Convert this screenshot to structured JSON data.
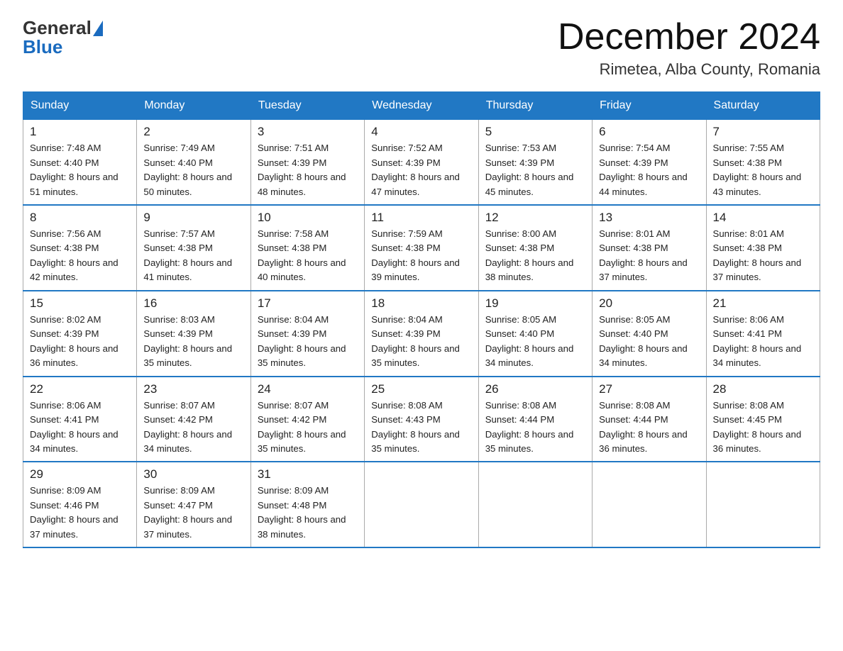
{
  "header": {
    "logo_general": "General",
    "logo_blue": "Blue",
    "title": "December 2024",
    "subtitle": "Rimetea, Alba County, Romania"
  },
  "days_of_week": [
    "Sunday",
    "Monday",
    "Tuesday",
    "Wednesday",
    "Thursday",
    "Friday",
    "Saturday"
  ],
  "weeks": [
    [
      {
        "num": "1",
        "sunrise": "7:48 AM",
        "sunset": "4:40 PM",
        "daylight": "8 hours and 51 minutes."
      },
      {
        "num": "2",
        "sunrise": "7:49 AM",
        "sunset": "4:40 PM",
        "daylight": "8 hours and 50 minutes."
      },
      {
        "num": "3",
        "sunrise": "7:51 AM",
        "sunset": "4:39 PM",
        "daylight": "8 hours and 48 minutes."
      },
      {
        "num": "4",
        "sunrise": "7:52 AM",
        "sunset": "4:39 PM",
        "daylight": "8 hours and 47 minutes."
      },
      {
        "num": "5",
        "sunrise": "7:53 AM",
        "sunset": "4:39 PM",
        "daylight": "8 hours and 45 minutes."
      },
      {
        "num": "6",
        "sunrise": "7:54 AM",
        "sunset": "4:39 PM",
        "daylight": "8 hours and 44 minutes."
      },
      {
        "num": "7",
        "sunrise": "7:55 AM",
        "sunset": "4:38 PM",
        "daylight": "8 hours and 43 minutes."
      }
    ],
    [
      {
        "num": "8",
        "sunrise": "7:56 AM",
        "sunset": "4:38 PM",
        "daylight": "8 hours and 42 minutes."
      },
      {
        "num": "9",
        "sunrise": "7:57 AM",
        "sunset": "4:38 PM",
        "daylight": "8 hours and 41 minutes."
      },
      {
        "num": "10",
        "sunrise": "7:58 AM",
        "sunset": "4:38 PM",
        "daylight": "8 hours and 40 minutes."
      },
      {
        "num": "11",
        "sunrise": "7:59 AM",
        "sunset": "4:38 PM",
        "daylight": "8 hours and 39 minutes."
      },
      {
        "num": "12",
        "sunrise": "8:00 AM",
        "sunset": "4:38 PM",
        "daylight": "8 hours and 38 minutes."
      },
      {
        "num": "13",
        "sunrise": "8:01 AM",
        "sunset": "4:38 PM",
        "daylight": "8 hours and 37 minutes."
      },
      {
        "num": "14",
        "sunrise": "8:01 AM",
        "sunset": "4:38 PM",
        "daylight": "8 hours and 37 minutes."
      }
    ],
    [
      {
        "num": "15",
        "sunrise": "8:02 AM",
        "sunset": "4:39 PM",
        "daylight": "8 hours and 36 minutes."
      },
      {
        "num": "16",
        "sunrise": "8:03 AM",
        "sunset": "4:39 PM",
        "daylight": "8 hours and 35 minutes."
      },
      {
        "num": "17",
        "sunrise": "8:04 AM",
        "sunset": "4:39 PM",
        "daylight": "8 hours and 35 minutes."
      },
      {
        "num": "18",
        "sunrise": "8:04 AM",
        "sunset": "4:39 PM",
        "daylight": "8 hours and 35 minutes."
      },
      {
        "num": "19",
        "sunrise": "8:05 AM",
        "sunset": "4:40 PM",
        "daylight": "8 hours and 34 minutes."
      },
      {
        "num": "20",
        "sunrise": "8:05 AM",
        "sunset": "4:40 PM",
        "daylight": "8 hours and 34 minutes."
      },
      {
        "num": "21",
        "sunrise": "8:06 AM",
        "sunset": "4:41 PM",
        "daylight": "8 hours and 34 minutes."
      }
    ],
    [
      {
        "num": "22",
        "sunrise": "8:06 AM",
        "sunset": "4:41 PM",
        "daylight": "8 hours and 34 minutes."
      },
      {
        "num": "23",
        "sunrise": "8:07 AM",
        "sunset": "4:42 PM",
        "daylight": "8 hours and 34 minutes."
      },
      {
        "num": "24",
        "sunrise": "8:07 AM",
        "sunset": "4:42 PM",
        "daylight": "8 hours and 35 minutes."
      },
      {
        "num": "25",
        "sunrise": "8:08 AM",
        "sunset": "4:43 PM",
        "daylight": "8 hours and 35 minutes."
      },
      {
        "num": "26",
        "sunrise": "8:08 AM",
        "sunset": "4:44 PM",
        "daylight": "8 hours and 35 minutes."
      },
      {
        "num": "27",
        "sunrise": "8:08 AM",
        "sunset": "4:44 PM",
        "daylight": "8 hours and 36 minutes."
      },
      {
        "num": "28",
        "sunrise": "8:08 AM",
        "sunset": "4:45 PM",
        "daylight": "8 hours and 36 minutes."
      }
    ],
    [
      {
        "num": "29",
        "sunrise": "8:09 AM",
        "sunset": "4:46 PM",
        "daylight": "8 hours and 37 minutes."
      },
      {
        "num": "30",
        "sunrise": "8:09 AM",
        "sunset": "4:47 PM",
        "daylight": "8 hours and 37 minutes."
      },
      {
        "num": "31",
        "sunrise": "8:09 AM",
        "sunset": "4:48 PM",
        "daylight": "8 hours and 38 minutes."
      },
      null,
      null,
      null,
      null
    ]
  ],
  "labels": {
    "sunrise": "Sunrise: ",
    "sunset": "Sunset: ",
    "daylight": "Daylight: "
  }
}
